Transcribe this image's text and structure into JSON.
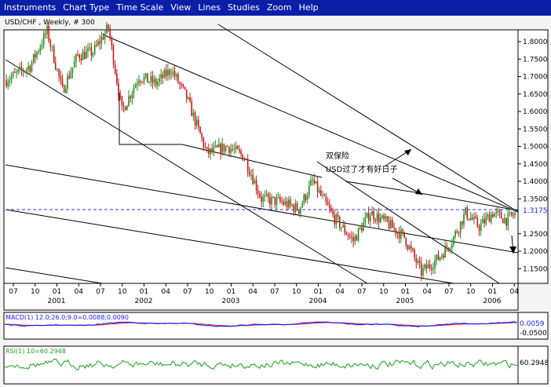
{
  "menu": [
    "Instruments",
    "Chart Type",
    "Time Scale",
    "View",
    "Lines",
    "Studies",
    "Zoom",
    "Help"
  ],
  "chart_data": [
    {
      "type": "candlestick",
      "title": "USD/CHF , Weekly, # 300",
      "price_axis": {
        "ticks": [
          "1.8000",
          "1.7500",
          "1.7000",
          "1.6500",
          "1.6000",
          "1.5500",
          "1.5000",
          "1.4500",
          "1.4000",
          "1.3500",
          "1.2500",
          "1.2000",
          "1.1500"
        ],
        "range": [
          1.12,
          1.85
        ]
      },
      "current_price_label": "1.3175",
      "time_axis": {
        "month_ticks": [
          "07",
          "10",
          "01",
          "04",
          "07",
          "10",
          "01",
          "04",
          "07",
          "10",
          "01",
          "04",
          "07",
          "10",
          "01",
          "04",
          "07",
          "10",
          "01",
          "04",
          "07",
          "10",
          "01",
          "04"
        ],
        "year_labels": [
          "2001",
          "2002",
          "2003",
          "2004",
          "2005",
          "2006"
        ]
      },
      "series": [
        {
          "start": "2000-07",
          "weeks": 300,
          "anchors": [
            [
              0,
              1.69
            ],
            [
              14,
              1.73
            ],
            [
              24,
              1.83
            ],
            [
              33,
              1.66
            ],
            [
              42,
              1.76
            ],
            [
              51,
              1.77
            ],
            [
              60,
              1.84
            ],
            [
              68,
              1.6
            ],
            [
              78,
              1.7
            ],
            [
              88,
              1.68
            ],
            [
              97,
              1.72
            ],
            [
              106,
              1.64
            ],
            [
              118,
              1.48
            ],
            [
              130,
              1.5
            ],
            [
              140,
              1.47
            ],
            [
              150,
              1.35
            ],
            [
              162,
              1.34
            ],
            [
              172,
              1.32
            ],
            [
              180,
              1.4
            ],
            [
              192,
              1.3
            ],
            [
              204,
              1.23
            ],
            [
              214,
              1.31
            ],
            [
              224,
              1.28
            ],
            [
              234,
              1.24
            ],
            [
              244,
              1.14
            ],
            [
              254,
              1.18
            ],
            [
              262,
              1.23
            ],
            [
              270,
              1.31
            ],
            [
              278,
              1.27
            ],
            [
              286,
              1.31
            ],
            [
              294,
              1.29
            ],
            [
              300,
              1.31
            ]
          ]
        }
      ],
      "annotation": [
        "双保险",
        "USD过了才有好日子"
      ]
    },
    {
      "type": "line",
      "title": "MACD(1) 12.0;26.0;9.0=0.0088;0.0090",
      "y_ticks": [
        "0.0059",
        "-0.0500"
      ],
      "series": [
        {
          "name": "MACD",
          "color": "#1a1aff"
        },
        {
          "name": "Signal",
          "color": "#ff2020"
        }
      ]
    },
    {
      "type": "line",
      "title": "RSI(1) 10=60.2948",
      "y_ticks": [
        "60.2948"
      ],
      "series": [
        {
          "name": "RSI",
          "color": "#18a018"
        }
      ]
    }
  ]
}
